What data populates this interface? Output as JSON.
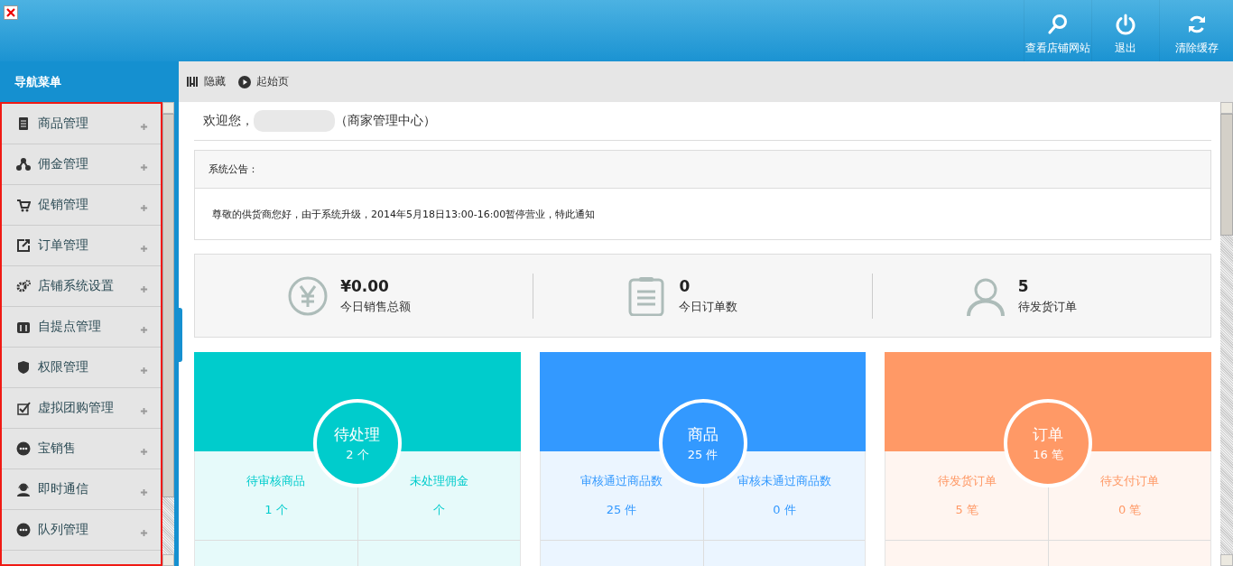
{
  "header": {
    "actions": [
      {
        "label": "查看店铺网站"
      },
      {
        "label": "退出"
      },
      {
        "label": "清除缓存"
      }
    ]
  },
  "sidebar": {
    "title": "导航菜单",
    "items": [
      {
        "label": "商品管理"
      },
      {
        "label": "佣金管理"
      },
      {
        "label": "促销管理"
      },
      {
        "label": "订单管理"
      },
      {
        "label": "店铺系统设置"
      },
      {
        "label": "自提点管理"
      },
      {
        "label": "权限管理"
      },
      {
        "label": "虚拟团购管理"
      },
      {
        "label": "宝销售"
      },
      {
        "label": "即时通信"
      },
      {
        "label": "队列管理"
      }
    ]
  },
  "toolbar": [
    {
      "label": "隐藏"
    },
    {
      "label": "起始页"
    }
  ],
  "welcome": {
    "greeting": "欢迎您，",
    "suffix": "（商家管理中心）"
  },
  "notice": {
    "title": "系统公告：",
    "text": "尊敬的供货商您好，由于系统升级，2014年5月18日13:00-16:00暂停营业，特此通知"
  },
  "stats": [
    {
      "value": "¥0.00",
      "label": "今日销售总额"
    },
    {
      "value": "0",
      "label": "今日订单数"
    },
    {
      "value": "5",
      "label": "待发货订单"
    }
  ],
  "cards": [
    {
      "title": "待处理",
      "count": "2 个",
      "color": "#00cccc",
      "cells": [
        {
          "label": "待审核商品",
          "value": "1 个"
        },
        {
          "label": "未处理佣金",
          "value": "个"
        }
      ]
    },
    {
      "title": "商品",
      "count": "25 件",
      "color": "#3399ff",
      "cells": [
        {
          "label": "审核通过商品数",
          "value": "25 件"
        },
        {
          "label": "审核未通过商品数",
          "value": "0 件"
        }
      ]
    },
    {
      "title": "订单",
      "count": "16 笔",
      "color": "#ff9966",
      "cells": [
        {
          "label": "待发货订单",
          "value": "5 笔"
        },
        {
          "label": "待支付订单",
          "value": "0 笔"
        }
      ]
    }
  ]
}
